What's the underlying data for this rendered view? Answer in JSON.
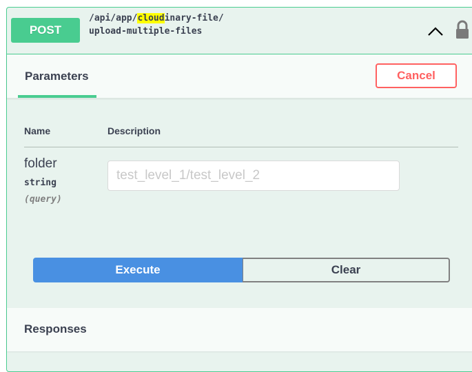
{
  "operation": {
    "method": "POST",
    "path_before": "/api/app/",
    "path_highlight": "cloud",
    "path_after": "inary-file/upload-multiple-files"
  },
  "parameters_tab": {
    "label": "Parameters"
  },
  "cancel_label": "Cancel",
  "table": {
    "col_name": "Name",
    "col_description": "Description"
  },
  "param": {
    "name": "folder",
    "type": "string",
    "in": "(query)",
    "placeholder": "test_level_1/test_level_2",
    "value": ""
  },
  "actions": {
    "execute_label": "Execute",
    "clear_label": "Clear"
  },
  "responses": {
    "label": "Responses"
  },
  "colors": {
    "post_green": "#49cc90",
    "execute_blue": "#4990e2",
    "cancel_red": "#ff6060",
    "block_bg": "#e8f3ee",
    "highlight": "#ffff00"
  },
  "icons": [
    "chevron-up-icon",
    "lock-icon"
  ]
}
